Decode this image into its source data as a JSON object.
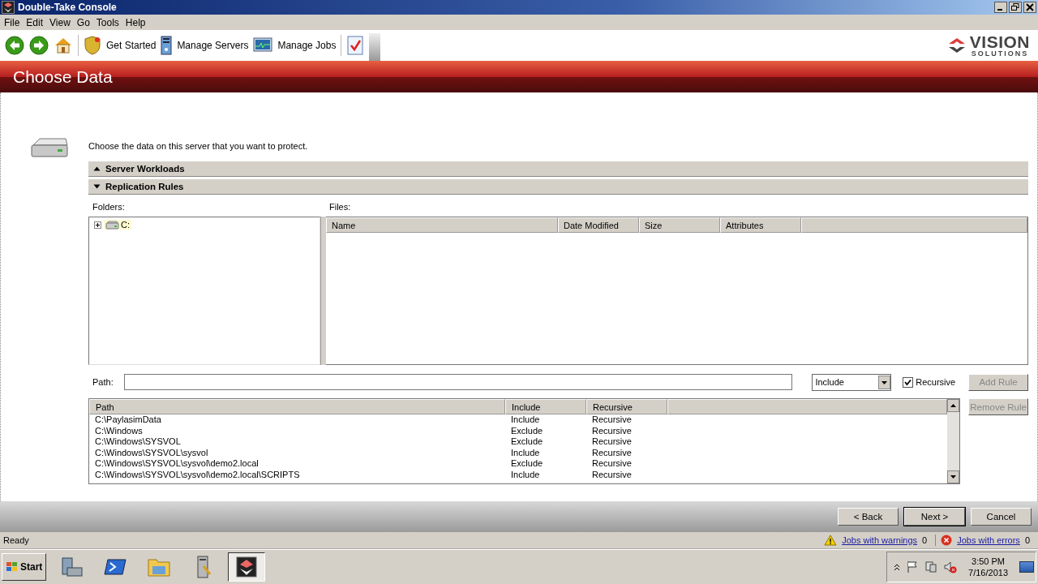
{
  "window": {
    "title": "Double-Take Console"
  },
  "menu": [
    "File",
    "Edit",
    "View",
    "Go",
    "Tools",
    "Help"
  ],
  "toolbar": [
    {
      "kind": "back"
    },
    {
      "kind": "forward"
    },
    {
      "kind": "home"
    },
    {
      "kind": "shield",
      "label": "Get Started"
    },
    {
      "kind": "server",
      "label": "Manage Servers"
    },
    {
      "kind": "monitor",
      "label": "Manage Jobs"
    },
    {
      "kind": "checklist"
    }
  ],
  "logo": {
    "name": "VISION",
    "tagline": "SOLUTIONS"
  },
  "page_title": "Choose Data",
  "instruction": "Choose the data on this server that you want to protect.",
  "sections": [
    {
      "label": "Server Workloads",
      "expanded": false
    },
    {
      "label": "Replication Rules",
      "expanded": true
    }
  ],
  "folders": {
    "label": "Folders:",
    "tree": [
      {
        "label": "C:",
        "expanded": false,
        "selected": true
      }
    ]
  },
  "files": {
    "label": "Files:",
    "columns": [
      "Name",
      "Date Modified",
      "Size",
      "Attributes"
    ]
  },
  "path": {
    "label": "Path:"
  },
  "rule_type": {
    "value": "Include"
  },
  "recursive": {
    "label": "Recursive",
    "checked": true
  },
  "rule_buttons": [
    {
      "label": "Add Rule",
      "disabled": true
    },
    {
      "label": "Remove Rule",
      "disabled": true
    }
  ],
  "rules": {
    "columns": [
      "Path",
      "Include",
      "Recursive"
    ],
    "rows": [
      {
        "path": "C:\\PaylasimData",
        "include": "Include",
        "recursive": "Recursive"
      },
      {
        "path": "C:\\Windows",
        "include": "Exclude",
        "recursive": "Recursive"
      },
      {
        "path": "C:\\Windows\\SYSVOL",
        "include": "Exclude",
        "recursive": "Recursive"
      },
      {
        "path": "C:\\Windows\\SYSVOL\\sysvol",
        "include": "Include",
        "recursive": "Recursive"
      },
      {
        "path": "C:\\Windows\\SYSVOL\\sysvol\\demo2.local",
        "include": "Exclude",
        "recursive": "Recursive"
      },
      {
        "path": "C:\\Windows\\SYSVOL\\sysvol\\demo2.local\\SCRIPTS",
        "include": "Include",
        "recursive": "Recursive"
      }
    ]
  },
  "nav_buttons": [
    {
      "label": "< Back",
      "default": false
    },
    {
      "label": "Next >",
      "default": true
    },
    {
      "label": "Cancel",
      "default": false
    }
  ],
  "status_bar": {
    "text": "Ready",
    "warnings": {
      "label": "Jobs with warnings",
      "count": "0"
    },
    "errors": {
      "label": "Jobs with errors",
      "count": "0"
    }
  },
  "taskbar": {
    "start": "Start",
    "apps": [
      {
        "kind": "toolbox",
        "selected": false
      },
      {
        "kind": "powershell",
        "selected": false
      },
      {
        "kind": "folder",
        "selected": false
      },
      {
        "kind": "server",
        "selected": false
      },
      {
        "kind": "doubletake",
        "selected": true
      }
    ],
    "time": "3:50 PM",
    "date": "7/16/2013"
  }
}
